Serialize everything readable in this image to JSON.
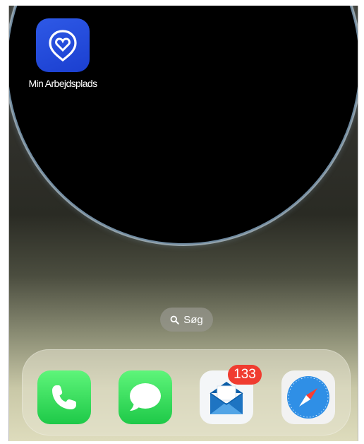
{
  "home": {
    "app": {
      "label": "Min Arbejdsplads",
      "icon": "heart-shield-icon"
    },
    "search": {
      "label": "Søg",
      "icon": "search-icon"
    }
  },
  "dock": {
    "apps": [
      {
        "name": "phone",
        "icon": "phone-icon",
        "color": "#2ad04f"
      },
      {
        "name": "messages",
        "icon": "message-bubble-icon",
        "color": "#2ad04f"
      },
      {
        "name": "mail",
        "icon": "envelope-icon",
        "badge": "133"
      },
      {
        "name": "safari",
        "icon": "compass-icon"
      }
    ]
  },
  "colors": {
    "app_icon_blue": "#2348dc",
    "badge_red": "#f03c30",
    "dock_green": "#2ad04f"
  }
}
